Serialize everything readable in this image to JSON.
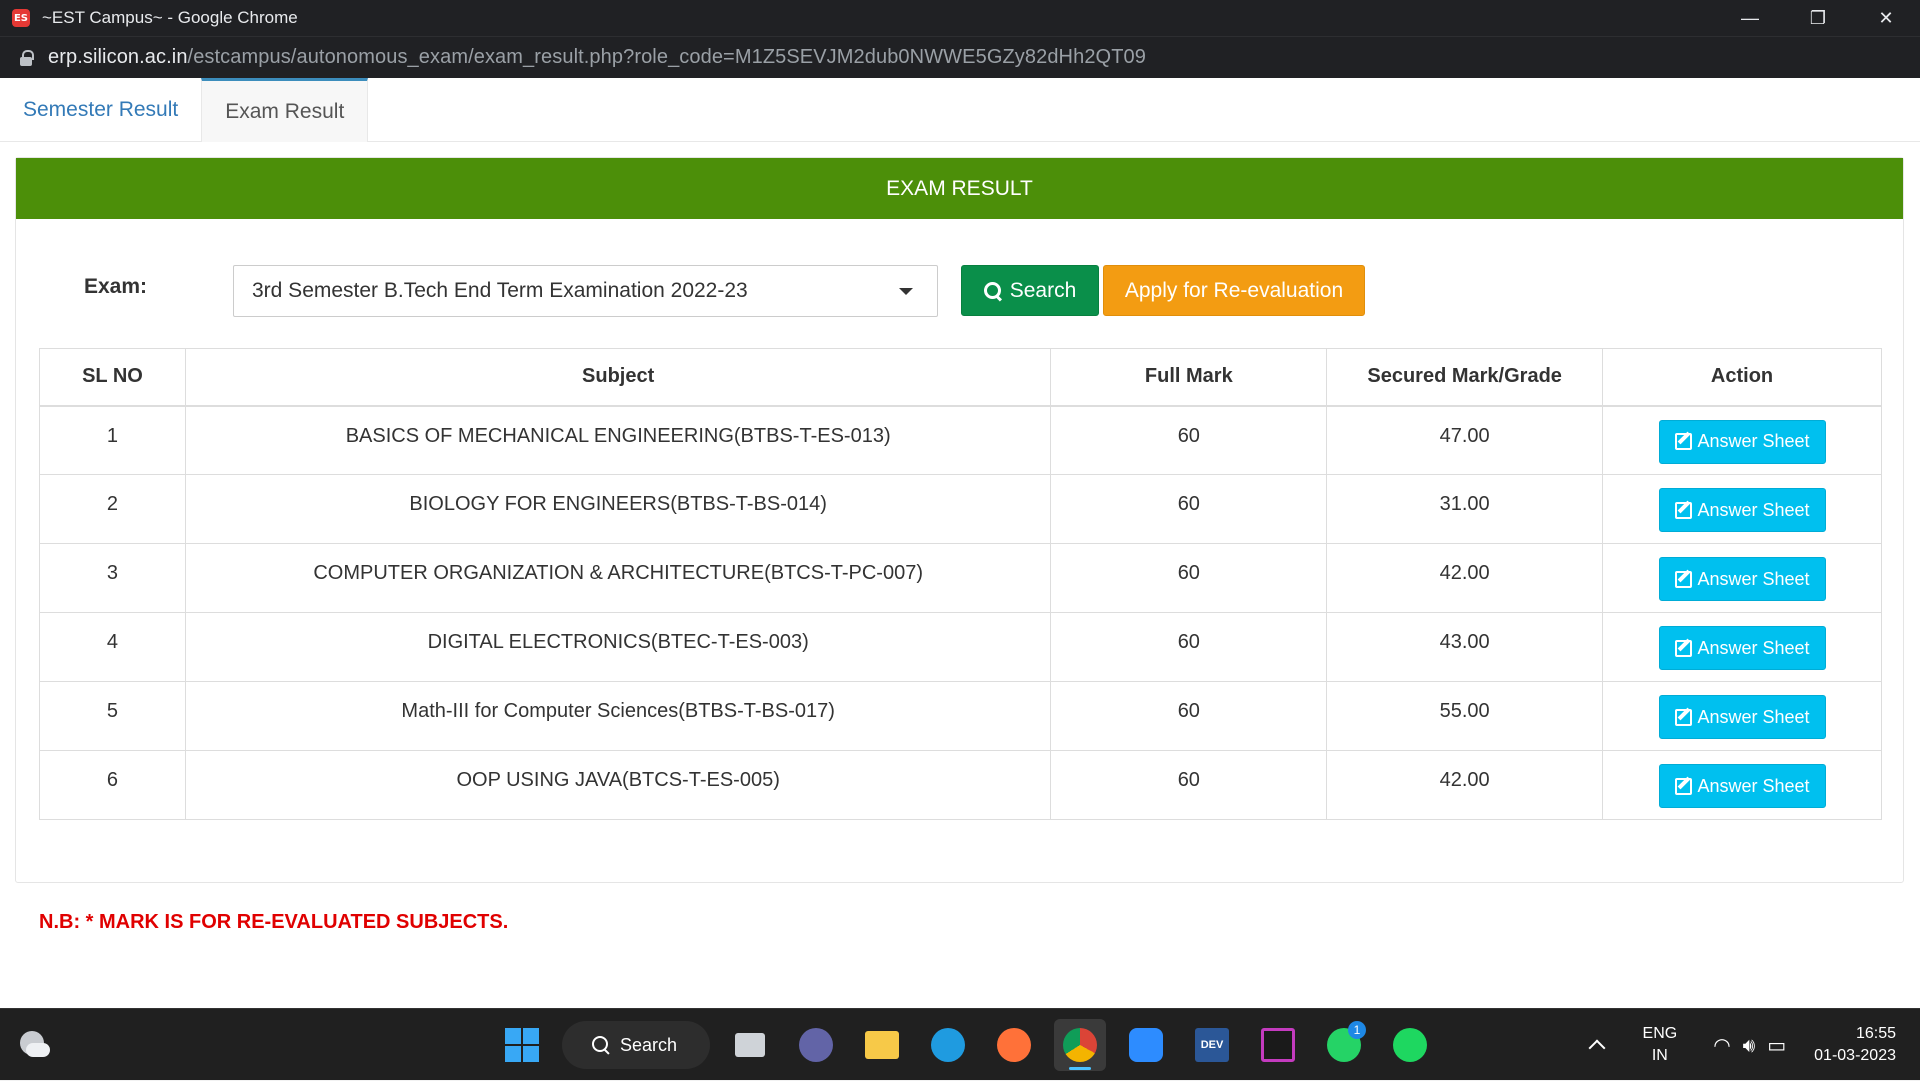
{
  "browser": {
    "window_title": "~EST Campus~ - Google Chrome",
    "logo_text": "ES",
    "url_host": "erp.silicon.ac.in",
    "url_path": "/estcampus/autonomous_exam/exam_result.php?role_code=M1Z5SEVJM2dub0NWWE5GZy82dHh2QT09",
    "controls": {
      "minimize": "—",
      "maximize": "❐",
      "close": "✕"
    }
  },
  "tabs": [
    {
      "label": "Semester Result",
      "active": false
    },
    {
      "label": "Exam Result",
      "active": true
    }
  ],
  "panel": {
    "heading": "EXAM RESULT",
    "heading_color": "#4c8f09"
  },
  "filter": {
    "exam_label": "Exam:",
    "exam_selected": "3rd Semester B.Tech End Term Examination 2022-23",
    "search_label": "Search",
    "reeval_label": "Apply for Re-evaluation"
  },
  "table": {
    "headers": [
      "SL NO",
      "Subject",
      "Full Mark",
      "Secured Mark/Grade",
      "Action"
    ],
    "action_label": "Answer Sheet",
    "rows": [
      {
        "sl": "1",
        "subject": "BASICS OF MECHANICAL ENGINEERING(BTBS-T-ES-013)",
        "full": "60",
        "secured": "47.00"
      },
      {
        "sl": "2",
        "subject": "BIOLOGY FOR ENGINEERS(BTBS-T-BS-014)",
        "full": "60",
        "secured": "31.00"
      },
      {
        "sl": "3",
        "subject": "COMPUTER ORGANIZATION & ARCHITECTURE(BTCS-T-PC-007)",
        "full": "60",
        "secured": "42.00"
      },
      {
        "sl": "4",
        "subject": "DIGITAL ELECTRONICS(BTEC-T-ES-003)",
        "full": "60",
        "secured": "43.00"
      },
      {
        "sl": "5",
        "subject": "Math-III for Computer Sciences(BTBS-T-BS-017)",
        "full": "60",
        "secured": "55.00"
      },
      {
        "sl": "6",
        "subject": "OOP USING JAVA(BTCS-T-ES-005)",
        "full": "60",
        "secured": "42.00"
      }
    ]
  },
  "note": "N.B: * MARK IS FOR RE-EVALUATED SUBJECTS.",
  "taskbar": {
    "search_label": "Search",
    "whatsapp_badge": "1",
    "dev_label": "DEV",
    "lang_top": "ENG",
    "lang_bottom": "IN",
    "time": "16:55",
    "date": "01-03-2023"
  }
}
